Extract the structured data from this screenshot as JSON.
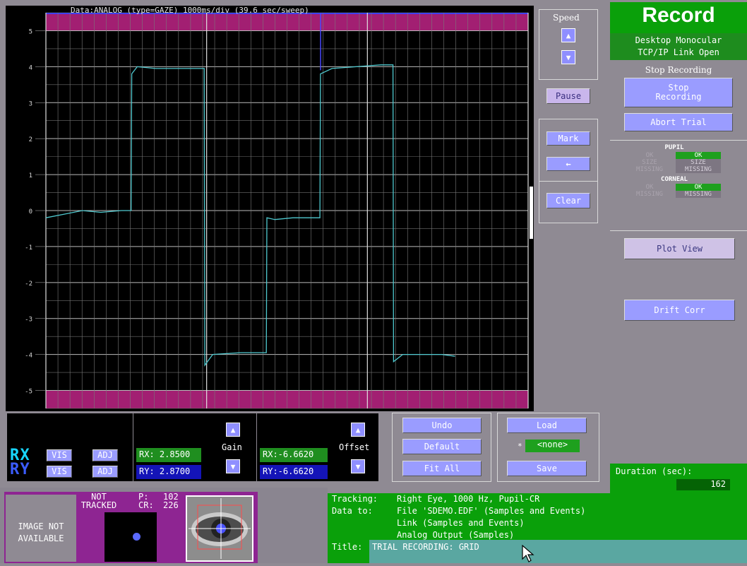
{
  "chart": {
    "title": "Data:ANALOG (type=GAZE)   1000ms/div (39.6 sec/sweep)",
    "y_ticks": [
      "5",
      "4",
      "3",
      "2",
      "1",
      "0",
      "-1",
      "-2",
      "-3",
      "-4",
      "-5"
    ]
  },
  "chart_data": {
    "type": "line",
    "title": "Data:ANALOG (type=GAZE)   1000ms/div (39.6 sec/sweep)",
    "xlabel": "",
    "ylabel": "",
    "ylim": [
      -5.5,
      5.5
    ],
    "xlim": [
      0,
      39.6
    ],
    "grid": true,
    "series": [
      {
        "color": "#4fc9cf",
        "x": [
          0,
          1.5,
          3.0,
          4.5,
          6.2,
          7.0,
          7.05,
          7.5,
          9.0,
          11.0,
          12.5,
          13.0,
          13.05,
          13.7,
          16.0,
          17.7,
          18.1,
          18.15,
          18.8,
          20.3,
          21.5,
          22.5,
          22.55,
          23.5,
          25.5,
          27.5,
          28.5,
          28.55,
          29.3,
          32.5,
          33.6
        ],
        "y": [
          -0.2,
          -0.1,
          0.0,
          -0.05,
          0.0,
          0.0,
          3.8,
          4.0,
          3.95,
          3.95,
          3.95,
          3.95,
          -4.3,
          -4.0,
          -3.95,
          -3.95,
          -3.95,
          -0.2,
          -0.25,
          -0.2,
          -0.2,
          -0.2,
          3.8,
          3.95,
          4.0,
          4.05,
          4.05,
          -4.2,
          -4.0,
          -4.0,
          -4.05
        ]
      }
    ]
  },
  "speed": {
    "label": "Speed",
    "pause": "Pause"
  },
  "mark": {
    "label": "Mark",
    "clear": "Clear",
    "back": "←"
  },
  "record": {
    "title": "Record",
    "device": "Desktop Monocular",
    "link": "TCP/IP Link Open",
    "section": "Stop Recording",
    "stop_btn": "Stop\nRecording",
    "abort_btn": "Abort Trial",
    "pupil_label": "PUPIL",
    "pupil_ok_dim": "OK",
    "pupil_size_dim": "SIZE",
    "pupil_missing_dim": "MISSING",
    "pupil_ok": "OK",
    "pupil_size": "SIZE",
    "pupil_missing": "MISSING",
    "corneal_label": "CORNEAL",
    "corneal_ok_dim": "OK",
    "corneal_missing_dim": "MISSING",
    "corneal_ok": "OK",
    "corneal_missing": "MISSING",
    "plot_view": "Plot View",
    "drift_corr": "Drift Corr",
    "duration_label": "Duration (sec):",
    "duration_value": "162"
  },
  "adjust": {
    "rx_label": "R X",
    "ry_label": "R Y",
    "vis": "VIS",
    "adj": "ADJ",
    "gain_label": "Gain",
    "gain_rx": "RX: 2.8500",
    "gain_ry": "RY: 2.8700",
    "offset_label": "Offset",
    "offset_rx": "RX:-6.6620",
    "offset_ry": "RY:-6.6620",
    "undo": "Undo",
    "default": "Default",
    "fit_all": "Fit All",
    "load": "Load",
    "none_mark": "*",
    "none": "<none>",
    "save": "Save"
  },
  "camera": {
    "image_na": "IMAGE NOT\nAVAILABLE",
    "not_tracked": "NOT\nTRACKED",
    "p_label": "P:",
    "p_value": "102",
    "cr_label": "CR:",
    "cr_value": "226"
  },
  "info": {
    "tracking_label": "Tracking:",
    "tracking_value": "Right Eye, 1000 Hz, Pupil-CR",
    "data_label": "Data to:",
    "data_line1": "File 'SDEMO.EDF' (Samples and Events)",
    "data_line2": "Link (Samples and Events)",
    "data_line3": "Analog Output (Samples)",
    "title_label": "Title:",
    "title_value": "TRIAL RECORDING: GRID"
  }
}
